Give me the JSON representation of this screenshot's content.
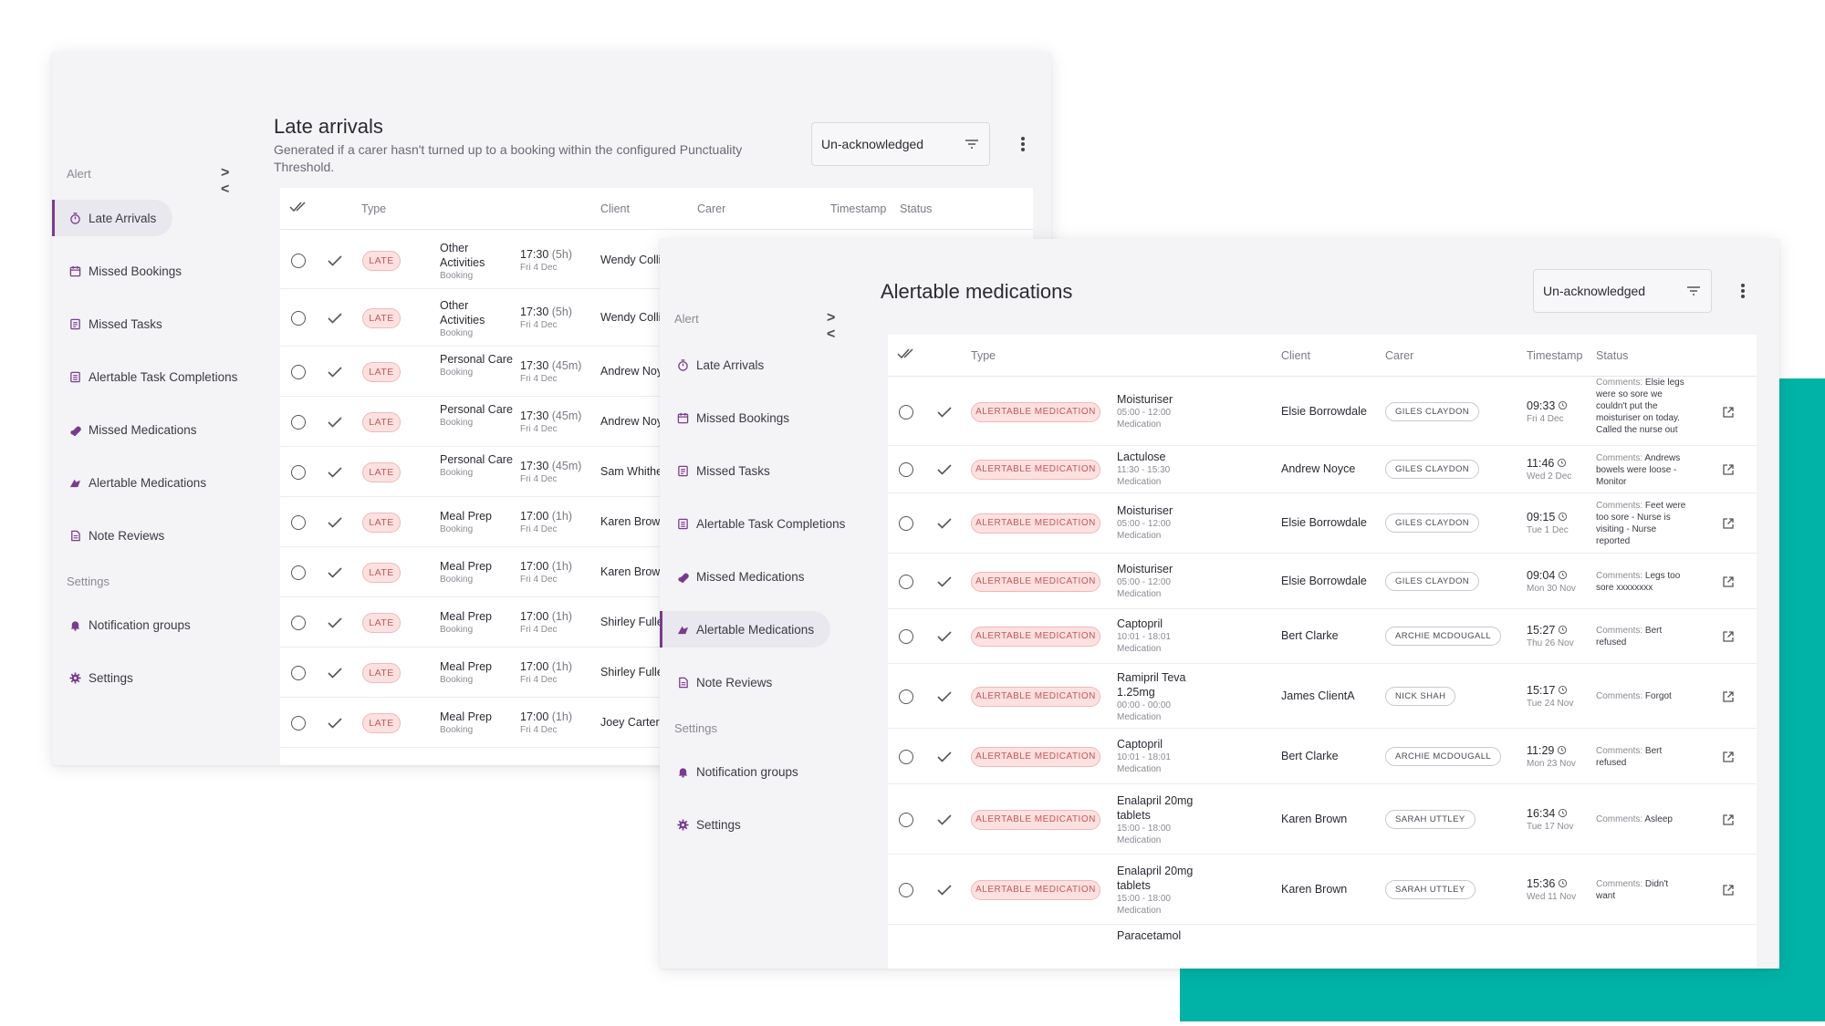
{
  "colors": {
    "accent": "#7a3b8f",
    "teal": "#00b3a6",
    "pill_bg": "#fde1e1",
    "pill_text": "#c45757"
  },
  "late_window": {
    "sidebar": {
      "alert_heading": "Alert",
      "collapse": "><",
      "items": [
        {
          "label": "Late Arrivals",
          "icon": "stopwatch-icon",
          "active": true
        },
        {
          "label": "Missed Bookings",
          "icon": "calendar-icon"
        },
        {
          "label": "Missed Tasks",
          "icon": "task-list-icon"
        },
        {
          "label": "Alertable Task Completions",
          "icon": "task-alert-icon"
        },
        {
          "label": "Missed Medications",
          "icon": "medication-icon"
        },
        {
          "label": "Alertable Medications",
          "icon": "medication-alert-icon"
        },
        {
          "label": "Note Reviews",
          "icon": "note-icon"
        }
      ],
      "settings_heading": "Settings",
      "settings_items": [
        {
          "label": "Notification groups",
          "icon": "bell-icon"
        },
        {
          "label": "Settings",
          "icon": "gear-icon"
        }
      ]
    },
    "title": "Late arrivals",
    "subtitle": "Generated if a carer hasn't turned up to a booking within the configured Punctuality Threshold.",
    "filter": "Un-acknowledged",
    "columns": {
      "type": "Type",
      "client": "Client",
      "carer": "Carer",
      "timestamp": "Timestamp",
      "status": "Status"
    },
    "rows": [
      {
        "badge": "LATE",
        "type": "Other Activities",
        "sub": "Booking",
        "time": "17:30",
        "dur": "(5h)",
        "date": "Fri 4 Dec",
        "client": "Wendy Collin"
      },
      {
        "badge": "LATE",
        "type": "Other Activities",
        "sub": "Booking",
        "time": "17:30",
        "dur": "(5h)",
        "date": "Fri 4 Dec",
        "client": "Wendy Collin"
      },
      {
        "badge": "LATE",
        "type": "Personal Care",
        "sub": "Booking",
        "time": "17:30",
        "dur": "(45m)",
        "date": "Fri 4 Dec",
        "client": "Andrew Noy"
      },
      {
        "badge": "LATE",
        "type": "Personal Care",
        "sub": "Booking",
        "time": "17:30",
        "dur": "(45m)",
        "date": "Fri 4 Dec",
        "client": "Andrew Noy"
      },
      {
        "badge": "LATE",
        "type": "Personal Care",
        "sub": "Booking",
        "time": "17:30",
        "dur": "(45m)",
        "date": "Fri 4 Dec",
        "client": "Sam Whither"
      },
      {
        "badge": "LATE",
        "type": "Meal Prep",
        "sub": "Booking",
        "time": "17:00",
        "dur": "(1h)",
        "date": "Fri 4 Dec",
        "client": "Karen Brown"
      },
      {
        "badge": "LATE",
        "type": "Meal Prep",
        "sub": "Booking",
        "time": "17:00",
        "dur": "(1h)",
        "date": "Fri 4 Dec",
        "client": "Karen Brown"
      },
      {
        "badge": "LATE",
        "type": "Meal Prep",
        "sub": "Booking",
        "time": "17:00",
        "dur": "(1h)",
        "date": "Fri 4 Dec",
        "client": "Shirley Fuller"
      },
      {
        "badge": "LATE",
        "type": "Meal Prep",
        "sub": "Booking",
        "time": "17:00",
        "dur": "(1h)",
        "date": "Fri 4 Dec",
        "client": "Shirley Fuller"
      },
      {
        "badge": "LATE",
        "type": "Meal Prep",
        "sub": "Booking",
        "time": "17:00",
        "dur": "(1h)",
        "date": "Fri 4 Dec",
        "client": "Joey Carter"
      }
    ]
  },
  "med_window": {
    "sidebar": {
      "alert_heading": "Alert",
      "collapse": "><",
      "items": [
        {
          "label": "Late Arrivals",
          "icon": "stopwatch-icon"
        },
        {
          "label": "Missed Bookings",
          "icon": "calendar-icon"
        },
        {
          "label": "Missed Tasks",
          "icon": "task-list-icon"
        },
        {
          "label": "Alertable Task Completions",
          "icon": "task-alert-icon"
        },
        {
          "label": "Missed Medications",
          "icon": "medication-icon"
        },
        {
          "label": "Alertable Medications",
          "icon": "medication-alert-icon",
          "active": true
        },
        {
          "label": "Note Reviews",
          "icon": "note-icon"
        }
      ],
      "settings_heading": "Settings",
      "settings_items": [
        {
          "label": "Notification groups",
          "icon": "bell-icon"
        },
        {
          "label": "Settings",
          "icon": "gear-icon"
        }
      ]
    },
    "title": "Alertable medications",
    "filter": "Un-acknowledged",
    "columns": {
      "type": "Type",
      "client": "Client",
      "carer": "Carer",
      "timestamp": "Timestamp",
      "status": "Status"
    },
    "rows": [
      {
        "badge": "ALERTABLE MEDICATION",
        "med": "Moisturiser",
        "window": "05:00 - 12:00",
        "sub": "Medication",
        "client": "Elsie Borrowdale",
        "carer": "GILES CLAYDON",
        "time": "09:33",
        "date": "Fri 4 Dec",
        "comment": "Elsie legs were so sore we couldn't put the moisturiser on today. Called the nurse out"
      },
      {
        "badge": "ALERTABLE MEDICATION",
        "med": "Lactulose",
        "window": "11:30 - 15:30",
        "sub": "Medication",
        "client": "Andrew Noyce",
        "carer": "GILES CLAYDON",
        "time": "11:46",
        "date": "Wed 2 Dec",
        "comment": "Andrews bowels were loose - Monitor"
      },
      {
        "badge": "ALERTABLE MEDICATION",
        "med": "Moisturiser",
        "window": "05:00 - 12:00",
        "sub": "Medication",
        "client": "Elsie Borrowdale",
        "carer": "GILES CLAYDON",
        "time": "09:15",
        "date": "Tue 1 Dec",
        "comment": "Feet were too sore - Nurse is visiting - Nurse reported"
      },
      {
        "badge": "ALERTABLE MEDICATION",
        "med": "Moisturiser",
        "window": "05:00 - 12:00",
        "sub": "Medication",
        "client": "Elsie Borrowdale",
        "carer": "GILES CLAYDON",
        "time": "09:04",
        "date": "Mon 30 Nov",
        "comment": "Legs too sore xxxxxxxx"
      },
      {
        "badge": "ALERTABLE MEDICATION",
        "med": "Captopril",
        "window": "10:01 - 18:01",
        "sub": "Medication",
        "client": "Bert Clarke",
        "carer": "ARCHIE MCDOUGALL",
        "time": "15:27",
        "date": "Thu 26 Nov",
        "comment": "Bert refused"
      },
      {
        "badge": "ALERTABLE MEDICATION",
        "med": "Ramipril Teva 1.25mg",
        "window": "00:00 - 00:00",
        "sub": "Medication",
        "client": "James ClientA",
        "carer": "NICK SHAH",
        "time": "15:17",
        "date": "Tue 24 Nov",
        "comment": "Forgot"
      },
      {
        "badge": "ALERTABLE MEDICATION",
        "med": "Captopril",
        "window": "10:01 - 18:01",
        "sub": "Medication",
        "client": "Bert Clarke",
        "carer": "ARCHIE MCDOUGALL",
        "time": "11:29",
        "date": "Mon 23 Nov",
        "comment": "Bert refused"
      },
      {
        "badge": "ALERTABLE MEDICATION",
        "med": "Enalapril 20mg tablets",
        "window": "15:00 - 18:00",
        "sub": "Medication",
        "client": "Karen Brown",
        "carer": "SARAH UTTLEY",
        "time": "16:34",
        "date": "Tue 17 Nov",
        "comment": "Asleep"
      },
      {
        "badge": "ALERTABLE MEDICATION",
        "med": "Enalapril 20mg tablets",
        "window": "15:00 - 18:00",
        "sub": "Medication",
        "client": "Karen Brown",
        "carer": "SARAH UTTLEY",
        "time": "15:36",
        "date": "Wed 11 Nov",
        "comment": "Didn't want"
      }
    ],
    "partial_row": "Paracetamol",
    "comments_label": "Comments:"
  }
}
